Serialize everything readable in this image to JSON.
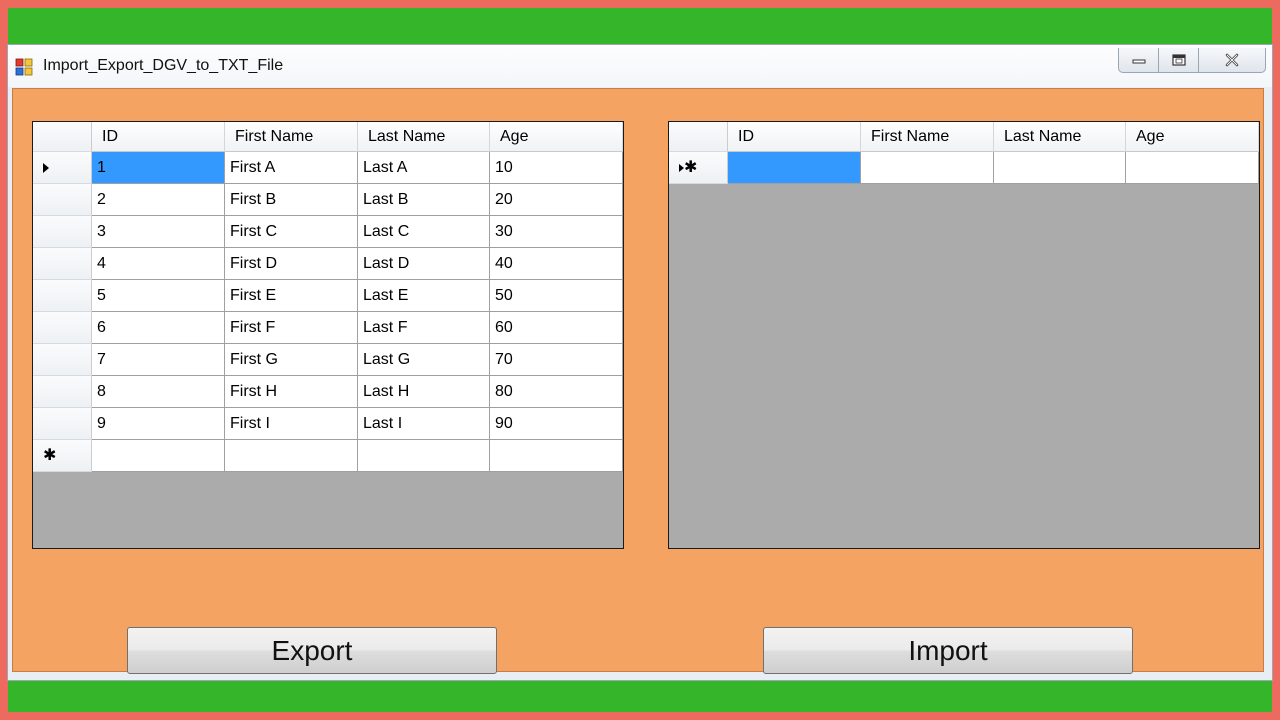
{
  "window": {
    "title": "Import_Export_DGV_to_TXT_File"
  },
  "left_grid": {
    "columns": [
      "ID",
      "First Name",
      "Last Name",
      "Age"
    ],
    "rows": [
      [
        "1",
        "First A",
        "Last A",
        "10"
      ],
      [
        "2",
        "First B",
        "Last B",
        "20"
      ],
      [
        "3",
        "First C",
        "Last C",
        "30"
      ],
      [
        "4",
        "First D",
        "Last D",
        "40"
      ],
      [
        "5",
        "First E",
        "Last E",
        "50"
      ],
      [
        "6",
        "First F",
        "Last F",
        "60"
      ],
      [
        "7",
        "First G",
        "Last G",
        "70"
      ],
      [
        "8",
        "First H",
        "Last H",
        "80"
      ],
      [
        "9",
        "First I",
        "Last I",
        "90"
      ]
    ],
    "current_row": 0,
    "new_row_marker": "✱"
  },
  "right_grid": {
    "columns": [
      "ID",
      "First Name",
      "Last Name",
      "Age"
    ],
    "rows": [],
    "new_row_marker": "✱"
  },
  "buttons": {
    "export_label": "Export",
    "import_label": "Import"
  },
  "colors": {
    "form_background": "#f4a362",
    "grid_background": "#ababab",
    "selection": "#3399ff",
    "outer_frame": "#ef6a5e",
    "green_band": "#35b62a"
  },
  "icons": {
    "app": "windows-form-icon",
    "minimize": "minimize-icon",
    "maximize": "maximize-icon",
    "close": "close-icon",
    "current_row": "row-pointer-icon",
    "new_row": "new-row-asterisk-icon"
  }
}
